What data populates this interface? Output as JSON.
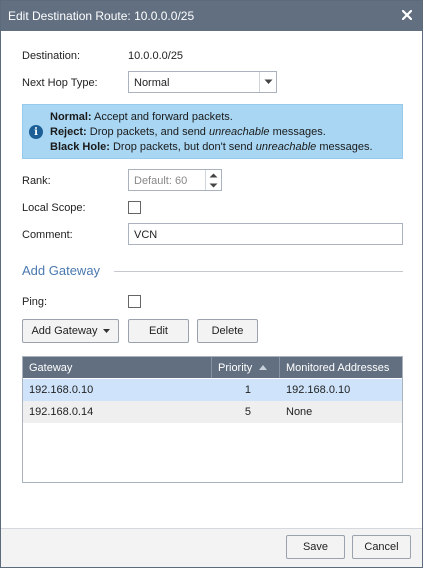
{
  "dialog": {
    "title": "Edit Destination Route: 10.0.0.0/25"
  },
  "form": {
    "destination_label": "Destination:",
    "destination_value": "10.0.0.0/25",
    "next_hop_label": "Next Hop Type:",
    "next_hop_value": "Normal",
    "info": {
      "normal_title": "Normal:",
      "normal_text": " Accept and forward packets.",
      "reject_title": "Reject:",
      "reject_text_1": " Drop packets, and send ",
      "reject_text_italic": "unreachable",
      "reject_text_2": " messages.",
      "blackhole_title": "Black Hole:",
      "blackhole_text_1": " Drop packets, but don't send ",
      "blackhole_text_italic": "unreachable",
      "blackhole_text_2": " messages."
    },
    "rank_label": "Rank:",
    "rank_placeholder": "Default: 60",
    "local_scope_label": "Local Scope:",
    "local_scope_checked": false,
    "comment_label": "Comment:",
    "comment_value": "VCN"
  },
  "gateway_section": {
    "title": "Add Gateway",
    "ping_label": "Ping:",
    "ping_checked": false,
    "buttons": {
      "add_gateway": "Add Gateway",
      "edit": "Edit",
      "delete": "Delete"
    },
    "table": {
      "columns": [
        "Gateway",
        "Priority",
        "Monitored Addresses"
      ],
      "rows": [
        {
          "gateway": "192.168.0.10",
          "priority": "1",
          "monitored": "192.168.0.10",
          "selected": true
        },
        {
          "gateway": "192.168.0.14",
          "priority": "5",
          "monitored": "None",
          "selected": false
        }
      ],
      "sort_column": "Priority",
      "sort_direction": "ascending"
    }
  },
  "footer": {
    "save": "Save",
    "cancel": "Cancel"
  },
  "colors": {
    "titlebar": "#616f81",
    "info_background": "#a8d6f3",
    "info_icon": "#1c5f96",
    "section_title": "#4a79b0",
    "selected_row": "#cfe4fb"
  },
  "icons": {
    "close": "close-icon",
    "info": "info-icon",
    "dropdown": "chevron-down-icon",
    "spinner_up": "chevron-up-icon",
    "spinner_down": "chevron-down-icon",
    "sort": "sort-ascending-icon"
  }
}
